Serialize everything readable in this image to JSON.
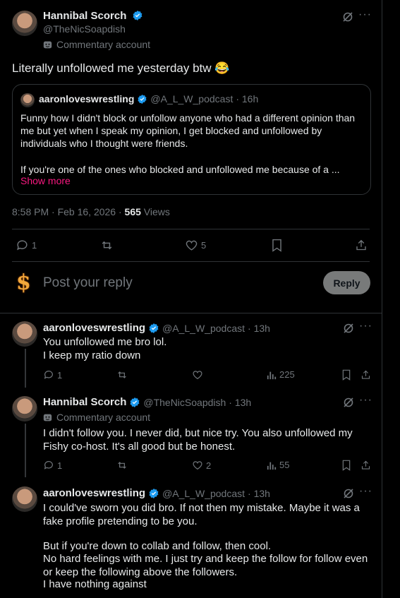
{
  "main_post": {
    "author_name": "Hannibal Scorch",
    "handle": "@TheNicSoapdish",
    "account_label": "Commentary account",
    "text": "Literally unfollowed me yesterday btw 😂",
    "quote": {
      "author_name": "aaronloveswrestling",
      "handle": "@A_L_W_podcast",
      "time": "· 16h",
      "text1": "Funny how I didn't block or unfollow anyone who had a different opinion than me but yet when I speak my opinion, I get blocked and unfollowed by individuals who I thought were friends.",
      "text2": "If you're one of the ones who blocked and unfollowed me because of a ...",
      "show_more": "Show more"
    },
    "timestamp": "8:58 PM · Feb 16, 2026 ·",
    "views_count": "565",
    "views_label": "Views",
    "replies": "1",
    "likes": "5"
  },
  "reply_box": {
    "placeholder": "Post your reply",
    "button": "Reply",
    "avatar_glyph": "$"
  },
  "replies": [
    {
      "author_name": "aaronloveswrestling",
      "handle": "@A_L_W_podcast",
      "time": "· 13h",
      "lines": [
        "You unfollowed me bro lol.",
        "I keep my ratio down"
      ],
      "replies": "1",
      "likes": "",
      "views": "225"
    },
    {
      "author_name": "Hannibal Scorch",
      "handle": "@TheNicSoapdish",
      "time": "· 13h",
      "account_label": "Commentary account",
      "text": "I didn't follow you. I never did, but nice try. You also unfollowed my Fishy co-host. It's all good but be honest.",
      "replies": "1",
      "likes": "2",
      "views": "55"
    },
    {
      "author_name": "aaronloveswrestling",
      "handle": "@A_L_W_podcast",
      "time": "· 13h",
      "text1": "I could've sworn you did bro. If not then my mistake. Maybe it was a fake profile pretending to be you.",
      "text2": "But if you're down to collab and follow, then cool.",
      "text3": "No hard feelings with me. I just try and keep the follow for follow even or keep the following above the followers.",
      "text4": "I have nothing against"
    }
  ],
  "colors": {
    "background": "#000000",
    "text": "#e7e9ea",
    "secondary": "#71767b",
    "link": "#f91880",
    "verified": "#1d9bf0",
    "border": "#2f3336"
  }
}
